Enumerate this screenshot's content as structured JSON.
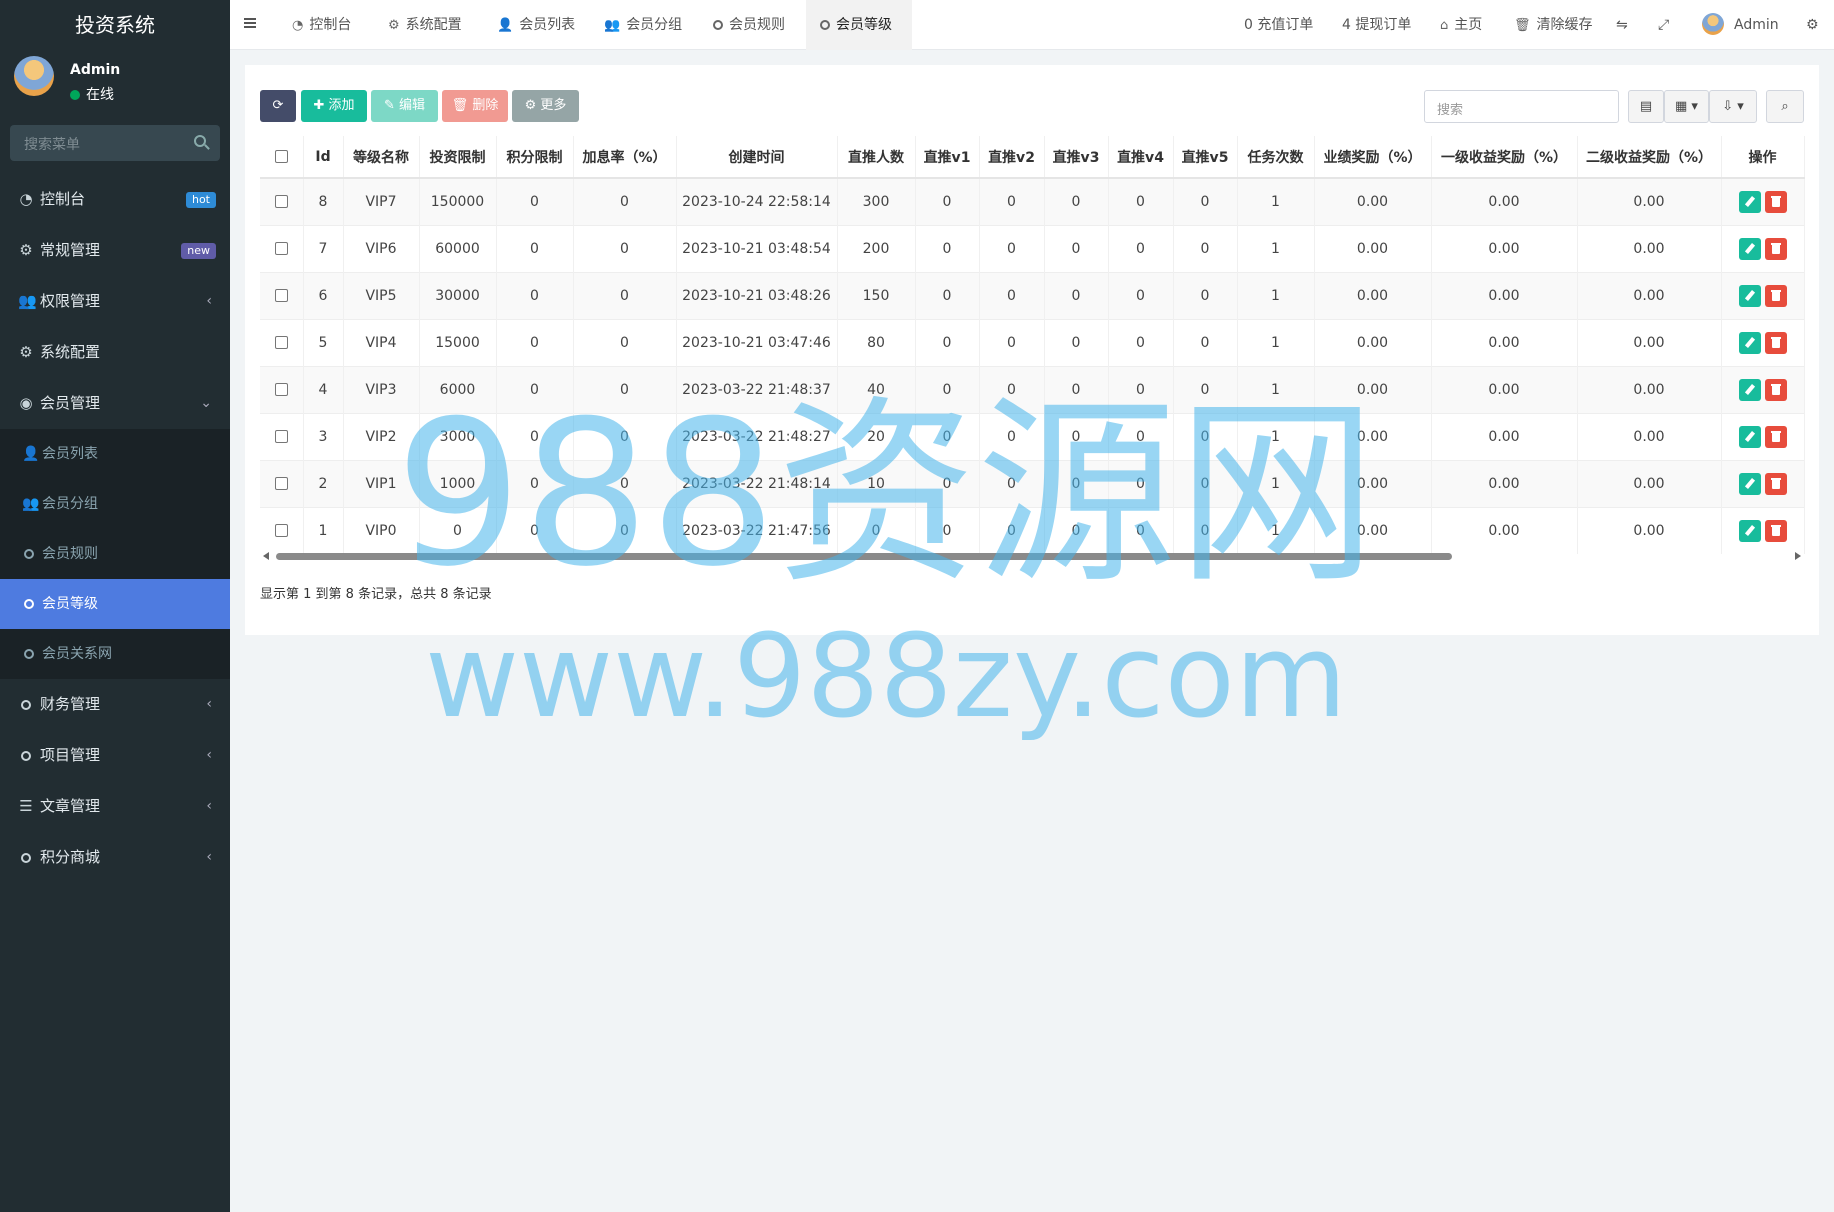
{
  "sidebar": {
    "brand": "投资系统",
    "user": {
      "name": "Admin",
      "status": "在线"
    },
    "search_placeholder": "搜索菜单",
    "menu": [
      {
        "label": "控制台",
        "icon": "dashboard-icon",
        "badge": "hot"
      },
      {
        "label": "常规管理",
        "icon": "cogs-icon",
        "badge": "new"
      },
      {
        "label": "权限管理",
        "icon": "users-icon",
        "chevron": "‹"
      },
      {
        "label": "系统配置",
        "icon": "gear-icon"
      },
      {
        "label": "会员管理",
        "icon": "user-circle-icon",
        "chevron": "⌄"
      }
    ],
    "submenu": [
      {
        "label": "会员列表",
        "icon": "user-icon"
      },
      {
        "label": "会员分组",
        "icon": "users-icon"
      },
      {
        "label": "会员规则",
        "icon": "circle-icon"
      },
      {
        "label": "会员等级",
        "icon": "circle-icon",
        "active": true
      },
      {
        "label": "会员关系网",
        "icon": "circle-icon"
      }
    ],
    "menu2": [
      {
        "label": "财务管理",
        "icon": "circle-icon",
        "chevron": "‹"
      },
      {
        "label": "项目管理",
        "icon": "circle-icon",
        "chevron": "‹"
      },
      {
        "label": "文章管理",
        "icon": "list-icon",
        "chevron": "‹"
      },
      {
        "label": "积分商城",
        "icon": "circle-icon",
        "chevron": "‹"
      }
    ]
  },
  "topbar": {
    "tabs": [
      "控制台",
      "系统配置",
      "会员列表",
      "会员分组",
      "会员规则",
      "会员等级"
    ],
    "right": {
      "recharge": "0 充值订单",
      "withdraw": "4 提现订单",
      "home": "主页",
      "clear_cache": "清除缓存",
      "admin": "Admin"
    }
  },
  "toolbar": {
    "add": "添加",
    "edit": "编辑",
    "delete": "删除",
    "more": "更多",
    "search_placeholder": "搜索"
  },
  "table": {
    "headers": [
      "Id",
      "等级名称",
      "投资限制",
      "积分限制",
      "加息率（%）",
      "创建时间",
      "直推人数",
      "直推v1",
      "直推v2",
      "直推v3",
      "直推v4",
      "直推v5",
      "任务次数",
      "业绩奖励（%）",
      "一级收益奖励（%）",
      "二级收益奖励（%）",
      "操作"
    ],
    "rows": [
      [
        "8",
        "VIP7",
        "150000",
        "0",
        "0",
        "2023-10-24 22:58:14",
        "300",
        "0",
        "0",
        "0",
        "0",
        "0",
        "1",
        "0.00",
        "0.00",
        "0.00"
      ],
      [
        "7",
        "VIP6",
        "60000",
        "0",
        "0",
        "2023-10-21 03:48:54",
        "200",
        "0",
        "0",
        "0",
        "0",
        "0",
        "1",
        "0.00",
        "0.00",
        "0.00"
      ],
      [
        "6",
        "VIP5",
        "30000",
        "0",
        "0",
        "2023-10-21 03:48:26",
        "150",
        "0",
        "0",
        "0",
        "0",
        "0",
        "1",
        "0.00",
        "0.00",
        "0.00"
      ],
      [
        "5",
        "VIP4",
        "15000",
        "0",
        "0",
        "2023-10-21 03:47:46",
        "80",
        "0",
        "0",
        "0",
        "0",
        "0",
        "1",
        "0.00",
        "0.00",
        "0.00"
      ],
      [
        "4",
        "VIP3",
        "6000",
        "0",
        "0",
        "2023-03-22 21:48:37",
        "40",
        "0",
        "0",
        "0",
        "0",
        "0",
        "1",
        "0.00",
        "0.00",
        "0.00"
      ],
      [
        "3",
        "VIP2",
        "3000",
        "0",
        "0",
        "2023-03-22 21:48:27",
        "20",
        "0",
        "0",
        "0",
        "0",
        "0",
        "1",
        "0.00",
        "0.00",
        "0.00"
      ],
      [
        "2",
        "VIP1",
        "1000",
        "0",
        "0",
        "2023-03-22 21:48:14",
        "10",
        "0",
        "0",
        "0",
        "0",
        "0",
        "1",
        "0.00",
        "0.00",
        "0.00"
      ],
      [
        "1",
        "VIP0",
        "0",
        "0",
        "0",
        "2023-03-22 21:47:56",
        "0",
        "0",
        "0",
        "0",
        "0",
        "0",
        "1",
        "0.00",
        "0.00",
        "0.00"
      ]
    ]
  },
  "footer": {
    "page_info": "显示第 1 到第 8 条记录，总共 8 条记录"
  },
  "watermark": {
    "line1": "988资源网",
    "line2": "www.988zy.com"
  },
  "colors": {
    "sidebar": "#222d32",
    "active": "#4e7be0",
    "add": "#18bc9c",
    "edit": "#7dd8c6",
    "delete": "#f19a92",
    "more": "#95a5a6",
    "refresh": "#444c69"
  }
}
